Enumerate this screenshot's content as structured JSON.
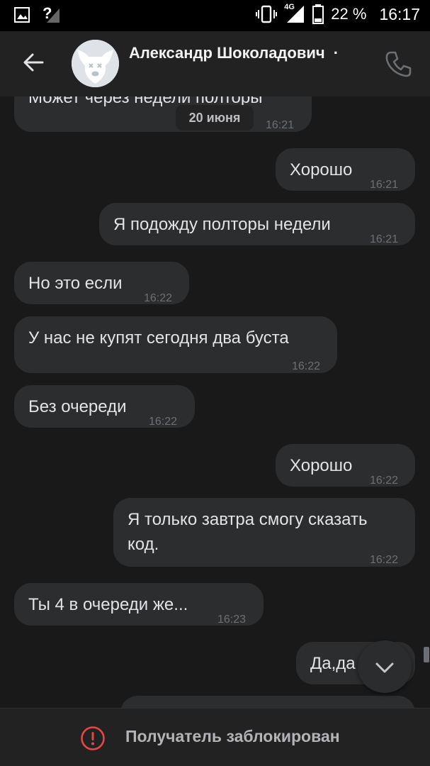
{
  "status_bar": {
    "battery": "22 %",
    "time": "16:17",
    "network": "4G",
    "signal_mark": "?",
    "icons": [
      "image-icon",
      "signal-icon",
      "vibrate-icon",
      "signal-4g-icon",
      "battery-icon"
    ]
  },
  "header": {
    "contact_name": "Александр Шоколадович",
    "separator": "·",
    "icons": [
      "back-arrow-icon",
      "avatar-dog-icon",
      "phone-icon"
    ]
  },
  "chat": {
    "date_chip": "20 июня",
    "messages": [
      {
        "side": "in",
        "text": "Может через недели полторы",
        "time": "16:21"
      },
      {
        "side": "out",
        "text": "Хорошо",
        "time": "16:21"
      },
      {
        "side": "out",
        "text": "Я подожду полторы недели",
        "time": "16:21"
      },
      {
        "side": "in",
        "text": "Но это если",
        "time": "16:22"
      },
      {
        "side": "in",
        "text": "У нас не купят сегодня два буста",
        "time": "16:22"
      },
      {
        "side": "in",
        "text": "Без очереди",
        "time": "16:22"
      },
      {
        "side": "out",
        "text": "Хорошо",
        "time": "16:22"
      },
      {
        "side": "out",
        "text_line1": "Я только завтра смогу сказать",
        "text_line2": "код.",
        "time": "16:22"
      },
      {
        "side": "in",
        "text": "Ты 4 в очереди же...",
        "time": "16:23"
      },
      {
        "side": "out",
        "text": "Да,да",
        "time": ""
      }
    ]
  },
  "scroll_down": {
    "icon": "chevron-down-icon"
  },
  "footer": {
    "blocked_text": "Получатель заблокирован",
    "icon": "exclamation-circle-icon",
    "accent_color": "#e64646"
  },
  "colors": {
    "background": "#19191a",
    "bubble": "#2c2d2e",
    "header": "#222222",
    "text": "#e1e3e6",
    "time": "#6c6f73"
  }
}
